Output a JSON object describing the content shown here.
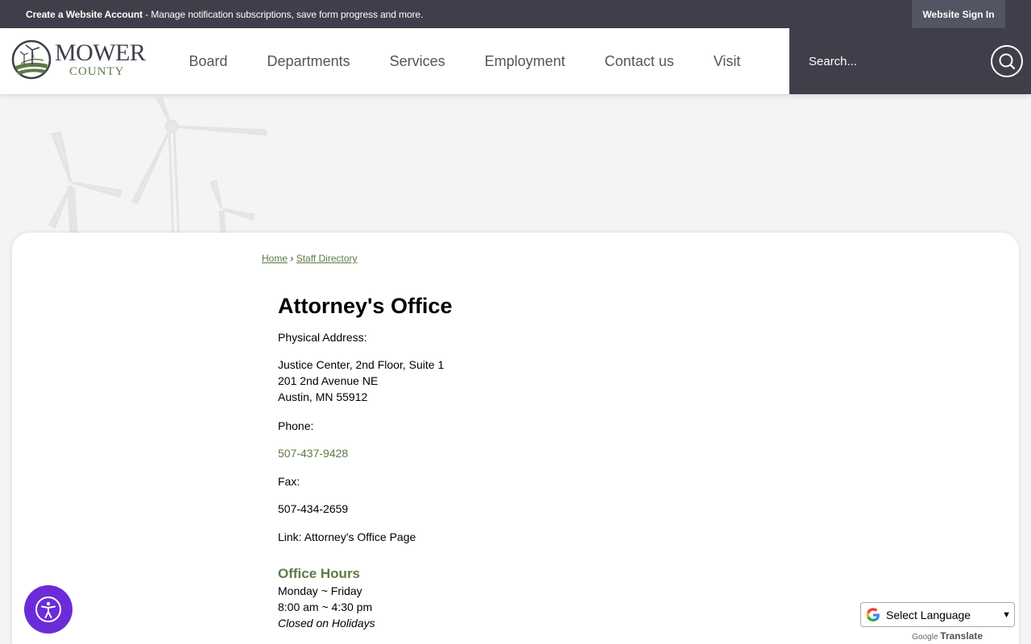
{
  "topbar": {
    "create_account": "Create a Website Account",
    "create_account_desc": " - Manage notification subscriptions, save form progress and more.",
    "sign_in": "Website Sign In"
  },
  "logo": {
    "line1": "MOWER",
    "line2": "COUNTY"
  },
  "nav": {
    "items": [
      "Board",
      "Departments",
      "Services",
      "Employment",
      "Contact us",
      "Visit"
    ]
  },
  "search": {
    "placeholder": "Search..."
  },
  "breadcrumb": {
    "home": "Home",
    "separator": "›",
    "current": "Staff Directory"
  },
  "main": {
    "title": "Attorney's Office",
    "physical_label": "Physical Address:",
    "address_lines": [
      "Justice Center, 2nd Floor, Suite 1",
      "201 2nd Avenue NE",
      "Austin, MN 55912"
    ],
    "phone_label": "Phone:",
    "phone": "507-437-9428",
    "fax_label": "Fax:",
    "fax": "507-434-2659",
    "link_text": "Link: Attorney's Office Page",
    "hours_title": "Office Hours",
    "hours_days": "Monday ~ Friday",
    "hours_time": "8:00 am ~ 4:30 pm",
    "hours_note": "Closed on Holidays"
  },
  "translate": {
    "select_label": "Select Language",
    "powered_by": "Google",
    "translate_word": "Translate"
  },
  "colors": {
    "dark": "#3e3f4a",
    "accent_green": "#5e7a46",
    "accessibility_purple": "#6c2bd9"
  }
}
